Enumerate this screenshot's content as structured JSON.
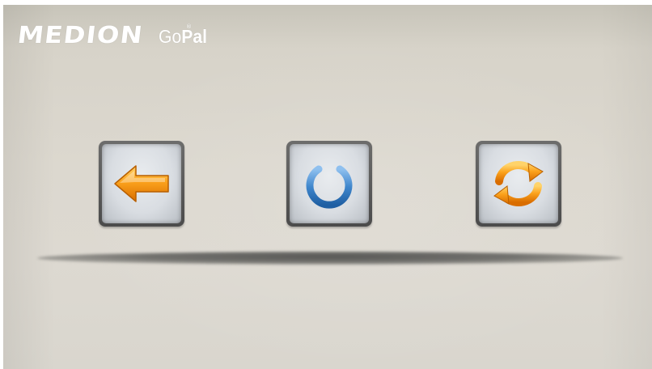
{
  "brand": {
    "name": "MEDION",
    "product_light": "Go",
    "product_bold": "Pal",
    "trademark": "®"
  },
  "buttons": [
    {
      "id": "back",
      "icon": "arrow-left-icon",
      "color": "#f59a0c"
    },
    {
      "id": "power",
      "icon": "power-icon",
      "color": "#3f86cc"
    },
    {
      "id": "refresh",
      "icon": "refresh-icon",
      "color": "#f59a0c"
    }
  ],
  "colors": {
    "background": "#dcd8cf",
    "button_frame": "#5a5a5a",
    "accent_orange": "#f59a0c",
    "accent_blue": "#3f86cc"
  }
}
